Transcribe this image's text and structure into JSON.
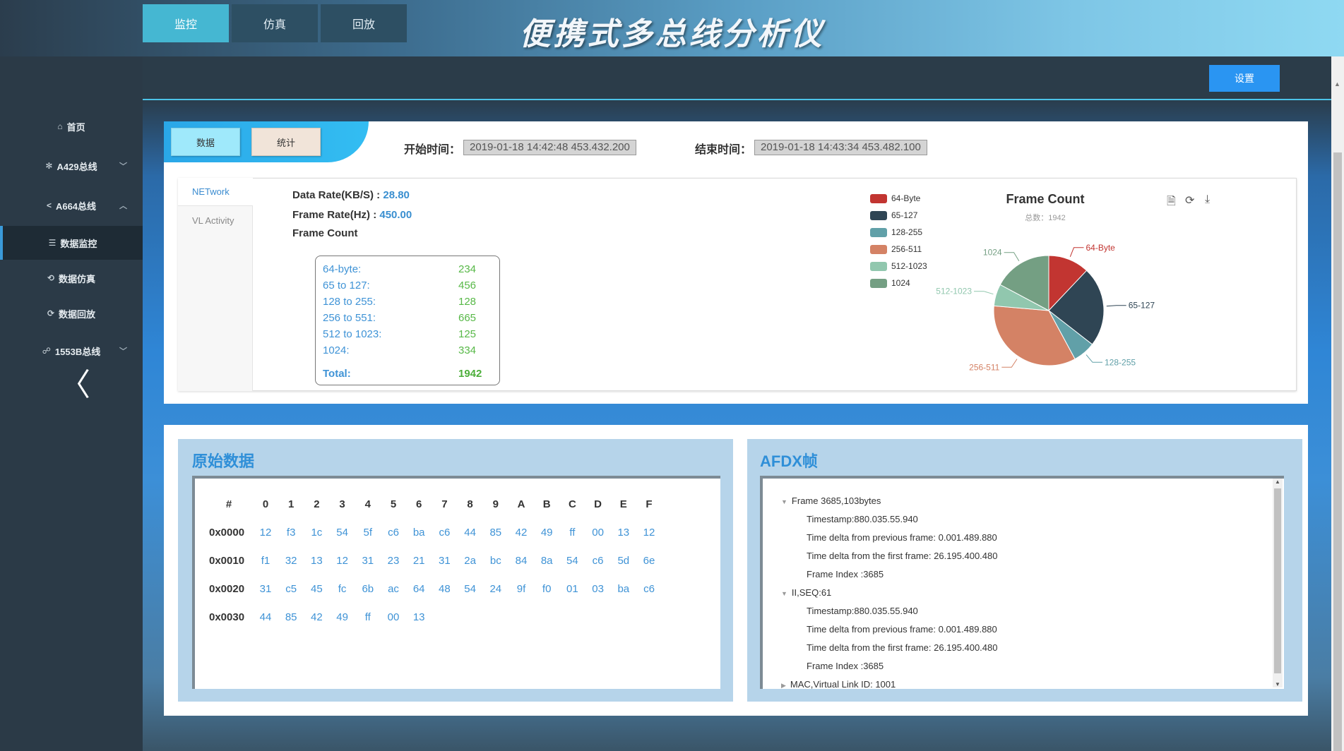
{
  "header": {
    "title": "便携式多总线分析仪"
  },
  "sidebar": {
    "items": [
      {
        "label": "首页",
        "icon": "home-icon",
        "glyph": "⌂"
      },
      {
        "label": "A429总线",
        "icon": "snowflake-icon",
        "glyph": "✻",
        "chevron": "﹀"
      },
      {
        "label": "A664总线",
        "icon": "share-icon",
        "glyph": "<",
        "chevron": "︿"
      },
      {
        "label": "数据监控",
        "icon": "list-icon",
        "glyph": "☰"
      },
      {
        "label": "数据仿真",
        "icon": "sim-icon",
        "glyph": "⟲"
      },
      {
        "label": "数据回放",
        "icon": "replay-icon",
        "glyph": "⟳"
      },
      {
        "label": "1553B总线",
        "icon": "network-icon",
        "glyph": "☍",
        "chevron": "﹀"
      }
    ],
    "back_glyph": "〈"
  },
  "tabs": [
    {
      "label": "监控"
    },
    {
      "label": "仿真"
    },
    {
      "label": "回放"
    }
  ],
  "settings_label": "设置",
  "toolbar": {
    "data_label": "数据",
    "stat_label": "统计"
  },
  "time": {
    "start_label": "开始时间：",
    "start_value": "2019-01-18 14:42:48 453.432.200",
    "end_label": "结束时间：",
    "end_value": "2019-01-18 14:43:34 453.482.100"
  },
  "subtabs": [
    {
      "label": "NETwork"
    },
    {
      "label": "VL Activity"
    }
  ],
  "rates": {
    "data_rate_label": "Data Rate(KB/S) :",
    "data_rate_value": "28.80",
    "frame_rate_label": "Frame Rate(Hz) :",
    "frame_rate_value": "450.00",
    "frame_count_label": "Frame Count"
  },
  "frame_table": {
    "rows": [
      {
        "label": "64-byte:",
        "value": "234"
      },
      {
        "label": "65 to 127:",
        "value": "456"
      },
      {
        "label": "128 to 255:",
        "value": "128"
      },
      {
        "label": "256 to 551:",
        "value": "665"
      },
      {
        "label": "512 to 1023:",
        "value": "125"
      },
      {
        "label": "1024:",
        "value": "334"
      }
    ],
    "total_label": "Total:",
    "total_value": "1942"
  },
  "chart_data": {
    "type": "pie",
    "title": "Frame Count",
    "subtitle": "总数：1942",
    "categories": [
      "64-Byte",
      "65-127",
      "128-255",
      "256-511",
      "512-1023",
      "1024"
    ],
    "values": [
      234,
      456,
      128,
      665,
      125,
      334
    ],
    "colors": [
      "#c23531",
      "#2f4554",
      "#61a0a8",
      "#d48265",
      "#91c7ae",
      "#749f83"
    ],
    "legend_position": "left"
  },
  "raw_data": {
    "title": "原始数据",
    "header": [
      "#",
      "0",
      "1",
      "2",
      "3",
      "4",
      "5",
      "6",
      "7",
      "8",
      "9",
      "A",
      "B",
      "C",
      "D",
      "E",
      "F"
    ],
    "rows": [
      {
        "addr": "0x0000",
        "bytes": [
          "12",
          "f3",
          "1c",
          "54",
          "5f",
          "c6",
          "ba",
          "c6",
          "44",
          "85",
          "42",
          "49",
          "ff",
          "00",
          "13",
          "12"
        ]
      },
      {
        "addr": "0x0010",
        "bytes": [
          "f1",
          "32",
          "13",
          "12",
          "31",
          "23",
          "21",
          "31",
          "2a",
          "bc",
          "84",
          "8a",
          "54",
          "c6",
          "5d",
          "6e"
        ]
      },
      {
        "addr": "0x0020",
        "bytes": [
          "31",
          "c5",
          "45",
          "fc",
          "6b",
          "ac",
          "64",
          "48",
          "54",
          "24",
          "9f",
          "f0",
          "01",
          "03",
          "ba",
          "c6"
        ]
      },
      {
        "addr": "0x0030",
        "bytes": [
          "44",
          "85",
          "42",
          "49",
          "ff",
          "00",
          "13"
        ]
      }
    ]
  },
  "afdx": {
    "title": "AFDX帧",
    "lines": [
      {
        "text": "Frame 3685,103bytes",
        "level": 0,
        "arrow": "▼"
      },
      {
        "text": "Timestamp:880.035.55.940",
        "level": 1
      },
      {
        "text": "Time delta from previous frame: 0.001.489.880",
        "level": 1
      },
      {
        "text": "Time delta from the first frame: 26.195.400.480",
        "level": 1
      },
      {
        "text": "Frame Index :3685",
        "level": 1
      },
      {
        "text": "II,SEQ:61",
        "level": 0,
        "arrow": "▼"
      },
      {
        "text": "Timestamp:880.035.55.940",
        "level": 1
      },
      {
        "text": "Time delta from previous frame: 0.001.489.880",
        "level": 1
      },
      {
        "text": "Time delta from the first frame: 26.195.400.480",
        "level": 1
      },
      {
        "text": "Frame Index :3685",
        "level": 1
      },
      {
        "text": "MAC,Virtual Link ID: 1001",
        "level": 0,
        "arrow": "▶"
      }
    ]
  }
}
